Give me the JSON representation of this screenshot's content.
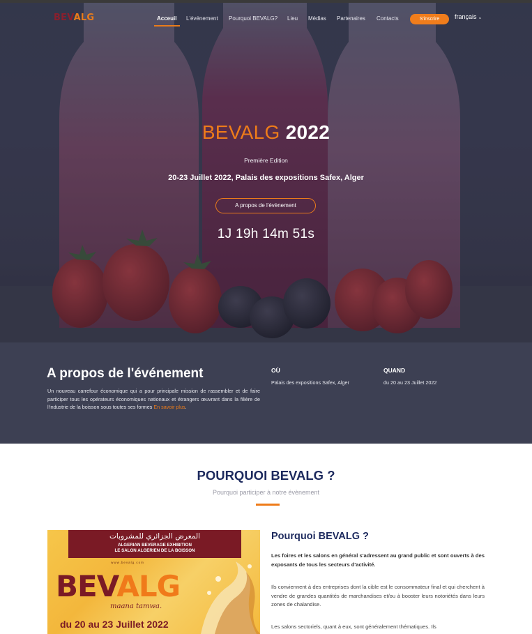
{
  "nav": {
    "logo_a": "BEV",
    "logo_b": "ALG",
    "items": [
      "Acceuil",
      "L'événement",
      "Pourquoi BEVALG?",
      "Lieu",
      "Médias",
      "Partenaires",
      "Contacts"
    ],
    "signup_label": "S'inscrire",
    "language": "français"
  },
  "hero": {
    "title_orange": "BEVALG",
    "title_white": "2022",
    "edition": "Première Edition",
    "date_place": "20-23 Juillet 2022, Palais des expositions Safex, Alger",
    "about_button": "A propos de l'évènement",
    "countdown": "1J 19h 14m 51s"
  },
  "about": {
    "title": "A propos de l'événement",
    "description": "Un nouveau carrefour économique qui a pour principale mission de rassembler et de faire participer tous les opérateurs économiques nationaux et étrangers œuvrant dans la filière de l'industrie de la boisson sous toutes ses formes",
    "more_link": "En savoir plus",
    "where_label": "OÙ",
    "where_value": "Palais des expositions Safex, Alger",
    "when_label": "QUAND",
    "when_value": "du 20 au 23 Juillet 2022"
  },
  "why": {
    "title": "POURQUOI BEVALG ?",
    "subtitle": "Pourquoi participer à notre évènement",
    "heading": "Pourquoi BEVALG ?",
    "p1": "Les foires et les salons en général s'adressent au grand public et sont ouverts à des exposants de tous les secteurs d'activité.",
    "p2": "Ils conviennent à des entreprises dont la cible est le consommateur final et qui cherchent à vendre de grandes quantités de marchandises et/ou à booster leurs notoriétés dans leurs zones de chalandise.",
    "p3": "Les salons sectoriels, quant à eux, sont généralement thématiques. Ils"
  },
  "poster": {
    "arabic": "المعرض الجزائري للمشروبات",
    "english_line1": "ALGERIAN BEVERAGE EXHIBITION",
    "english_line2": "LE SALON ALGERIEN DE LA BOISSON",
    "url": "www.bevalg.com",
    "logo_a": "BEV",
    "logo_b": "ALG",
    "tagline": "maana tamwa.",
    "date": "du 20 au 23 Juillet 2022"
  },
  "colors": {
    "accent": "#ee7c1a",
    "navy": "#1d2a5e",
    "band": "#3d4053",
    "brand_red": "#7a1a25"
  }
}
